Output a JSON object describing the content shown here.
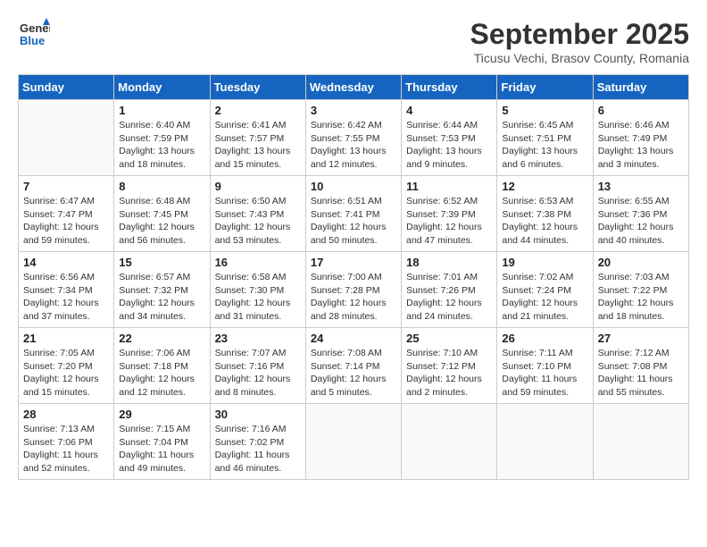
{
  "logo": {
    "line1": "General",
    "line2": "Blue"
  },
  "title": "September 2025",
  "subtitle": "Ticusu Vechi, Brasov County, Romania",
  "days_of_week": [
    "Sunday",
    "Monday",
    "Tuesday",
    "Wednesday",
    "Thursday",
    "Friday",
    "Saturday"
  ],
  "weeks": [
    [
      {
        "day": "",
        "sunrise": "",
        "sunset": "",
        "daylight": ""
      },
      {
        "day": "1",
        "sunrise": "Sunrise: 6:40 AM",
        "sunset": "Sunset: 7:59 PM",
        "daylight": "Daylight: 13 hours and 18 minutes."
      },
      {
        "day": "2",
        "sunrise": "Sunrise: 6:41 AM",
        "sunset": "Sunset: 7:57 PM",
        "daylight": "Daylight: 13 hours and 15 minutes."
      },
      {
        "day": "3",
        "sunrise": "Sunrise: 6:42 AM",
        "sunset": "Sunset: 7:55 PM",
        "daylight": "Daylight: 13 hours and 12 minutes."
      },
      {
        "day": "4",
        "sunrise": "Sunrise: 6:44 AM",
        "sunset": "Sunset: 7:53 PM",
        "daylight": "Daylight: 13 hours and 9 minutes."
      },
      {
        "day": "5",
        "sunrise": "Sunrise: 6:45 AM",
        "sunset": "Sunset: 7:51 PM",
        "daylight": "Daylight: 13 hours and 6 minutes."
      },
      {
        "day": "6",
        "sunrise": "Sunrise: 6:46 AM",
        "sunset": "Sunset: 7:49 PM",
        "daylight": "Daylight: 13 hours and 3 minutes."
      }
    ],
    [
      {
        "day": "7",
        "sunrise": "Sunrise: 6:47 AM",
        "sunset": "Sunset: 7:47 PM",
        "daylight": "Daylight: 12 hours and 59 minutes."
      },
      {
        "day": "8",
        "sunrise": "Sunrise: 6:48 AM",
        "sunset": "Sunset: 7:45 PM",
        "daylight": "Daylight: 12 hours and 56 minutes."
      },
      {
        "day": "9",
        "sunrise": "Sunrise: 6:50 AM",
        "sunset": "Sunset: 7:43 PM",
        "daylight": "Daylight: 12 hours and 53 minutes."
      },
      {
        "day": "10",
        "sunrise": "Sunrise: 6:51 AM",
        "sunset": "Sunset: 7:41 PM",
        "daylight": "Daylight: 12 hours and 50 minutes."
      },
      {
        "day": "11",
        "sunrise": "Sunrise: 6:52 AM",
        "sunset": "Sunset: 7:39 PM",
        "daylight": "Daylight: 12 hours and 47 minutes."
      },
      {
        "day": "12",
        "sunrise": "Sunrise: 6:53 AM",
        "sunset": "Sunset: 7:38 PM",
        "daylight": "Daylight: 12 hours and 44 minutes."
      },
      {
        "day": "13",
        "sunrise": "Sunrise: 6:55 AM",
        "sunset": "Sunset: 7:36 PM",
        "daylight": "Daylight: 12 hours and 40 minutes."
      }
    ],
    [
      {
        "day": "14",
        "sunrise": "Sunrise: 6:56 AM",
        "sunset": "Sunset: 7:34 PM",
        "daylight": "Daylight: 12 hours and 37 minutes."
      },
      {
        "day": "15",
        "sunrise": "Sunrise: 6:57 AM",
        "sunset": "Sunset: 7:32 PM",
        "daylight": "Daylight: 12 hours and 34 minutes."
      },
      {
        "day": "16",
        "sunrise": "Sunrise: 6:58 AM",
        "sunset": "Sunset: 7:30 PM",
        "daylight": "Daylight: 12 hours and 31 minutes."
      },
      {
        "day": "17",
        "sunrise": "Sunrise: 7:00 AM",
        "sunset": "Sunset: 7:28 PM",
        "daylight": "Daylight: 12 hours and 28 minutes."
      },
      {
        "day": "18",
        "sunrise": "Sunrise: 7:01 AM",
        "sunset": "Sunset: 7:26 PM",
        "daylight": "Daylight: 12 hours and 24 minutes."
      },
      {
        "day": "19",
        "sunrise": "Sunrise: 7:02 AM",
        "sunset": "Sunset: 7:24 PM",
        "daylight": "Daylight: 12 hours and 21 minutes."
      },
      {
        "day": "20",
        "sunrise": "Sunrise: 7:03 AM",
        "sunset": "Sunset: 7:22 PM",
        "daylight": "Daylight: 12 hours and 18 minutes."
      }
    ],
    [
      {
        "day": "21",
        "sunrise": "Sunrise: 7:05 AM",
        "sunset": "Sunset: 7:20 PM",
        "daylight": "Daylight: 12 hours and 15 minutes."
      },
      {
        "day": "22",
        "sunrise": "Sunrise: 7:06 AM",
        "sunset": "Sunset: 7:18 PM",
        "daylight": "Daylight: 12 hours and 12 minutes."
      },
      {
        "day": "23",
        "sunrise": "Sunrise: 7:07 AM",
        "sunset": "Sunset: 7:16 PM",
        "daylight": "Daylight: 12 hours and 8 minutes."
      },
      {
        "day": "24",
        "sunrise": "Sunrise: 7:08 AM",
        "sunset": "Sunset: 7:14 PM",
        "daylight": "Daylight: 12 hours and 5 minutes."
      },
      {
        "day": "25",
        "sunrise": "Sunrise: 7:10 AM",
        "sunset": "Sunset: 7:12 PM",
        "daylight": "Daylight: 12 hours and 2 minutes."
      },
      {
        "day": "26",
        "sunrise": "Sunrise: 7:11 AM",
        "sunset": "Sunset: 7:10 PM",
        "daylight": "Daylight: 11 hours and 59 minutes."
      },
      {
        "day": "27",
        "sunrise": "Sunrise: 7:12 AM",
        "sunset": "Sunset: 7:08 PM",
        "daylight": "Daylight: 11 hours and 55 minutes."
      }
    ],
    [
      {
        "day": "28",
        "sunrise": "Sunrise: 7:13 AM",
        "sunset": "Sunset: 7:06 PM",
        "daylight": "Daylight: 11 hours and 52 minutes."
      },
      {
        "day": "29",
        "sunrise": "Sunrise: 7:15 AM",
        "sunset": "Sunset: 7:04 PM",
        "daylight": "Daylight: 11 hours and 49 minutes."
      },
      {
        "day": "30",
        "sunrise": "Sunrise: 7:16 AM",
        "sunset": "Sunset: 7:02 PM",
        "daylight": "Daylight: 11 hours and 46 minutes."
      },
      {
        "day": "",
        "sunrise": "",
        "sunset": "",
        "daylight": ""
      },
      {
        "day": "",
        "sunrise": "",
        "sunset": "",
        "daylight": ""
      },
      {
        "day": "",
        "sunrise": "",
        "sunset": "",
        "daylight": ""
      },
      {
        "day": "",
        "sunrise": "",
        "sunset": "",
        "daylight": ""
      }
    ]
  ]
}
